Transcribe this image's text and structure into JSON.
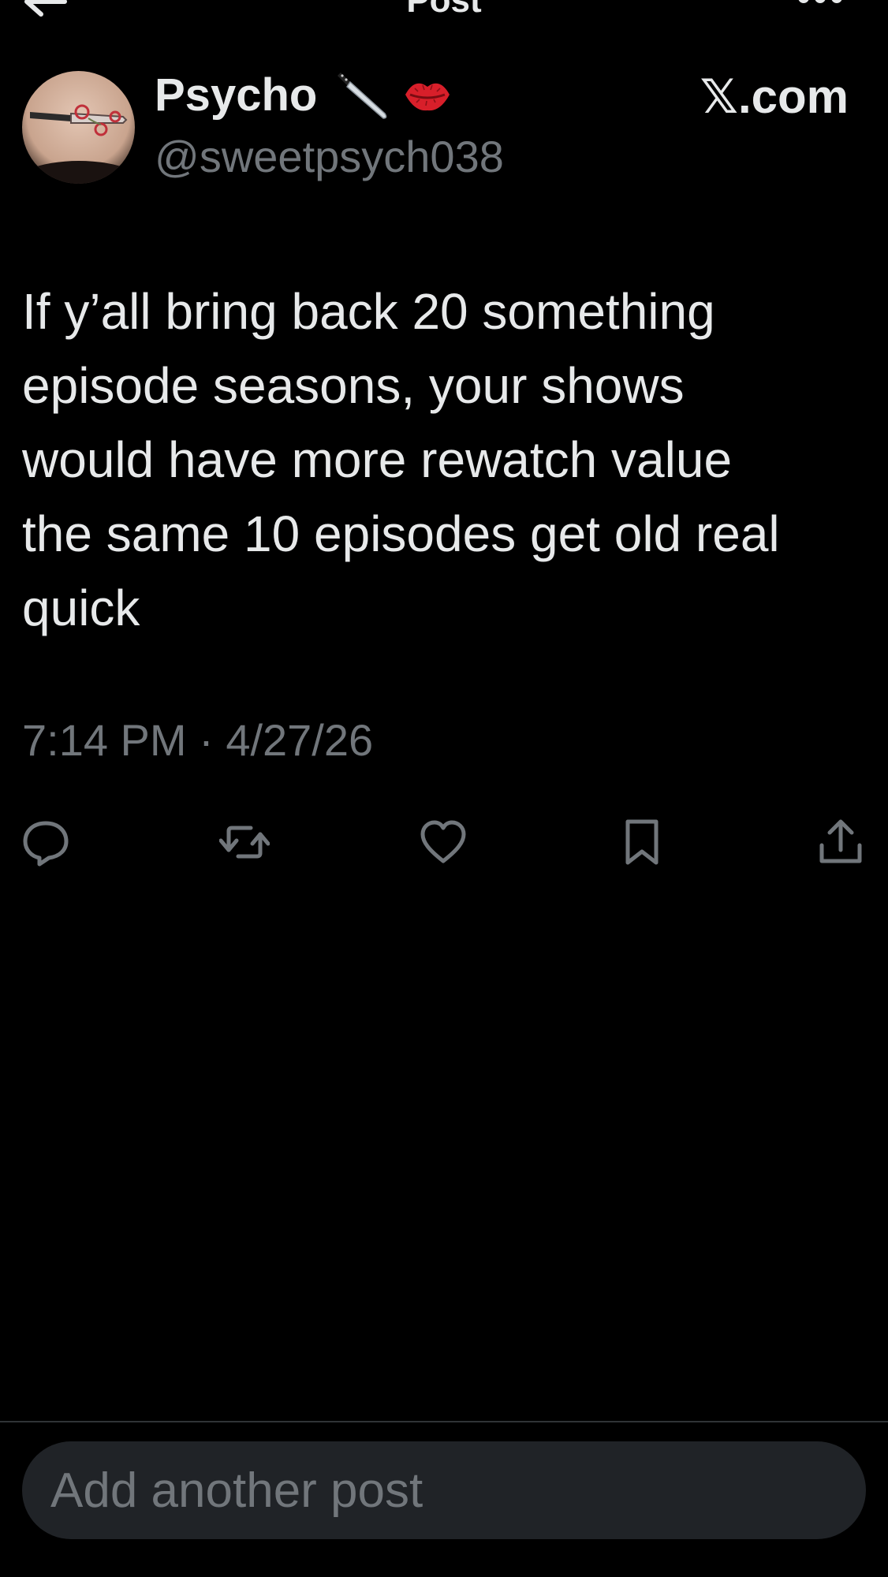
{
  "nav": {
    "title": "Post",
    "back_icon": "arrow-left-icon",
    "more_icon": "more-horizontal-icon"
  },
  "author": {
    "display_name": "Psycho",
    "handle": "@sweetpsych038",
    "emojis": [
      "kitchen-knife-emoji",
      "kiss-mark-emoji"
    ],
    "avatar": "avatar-tattoo-photo"
  },
  "watermark": "𝕏.com",
  "post": {
    "text": "If y’all bring back 20 something\nepisode seasons, your shows\nwould have more rewatch value\nthe same 10 episodes get old real\nquick",
    "timestamp": "7:14 PM · 4/27/26"
  },
  "actions": [
    {
      "name": "reply",
      "icon": "reply-icon"
    },
    {
      "name": "repost",
      "icon": "repost-icon"
    },
    {
      "name": "like",
      "icon": "heart-icon"
    },
    {
      "name": "bookmark",
      "icon": "bookmark-icon"
    },
    {
      "name": "share",
      "icon": "share-icon"
    }
  ],
  "composer": {
    "placeholder": "Add another post"
  },
  "colors": {
    "background": "#000000",
    "text_primary": "#e7e9ea",
    "text_secondary": "#71767b",
    "composer_bg": "#202327",
    "divider": "#2f3336"
  }
}
